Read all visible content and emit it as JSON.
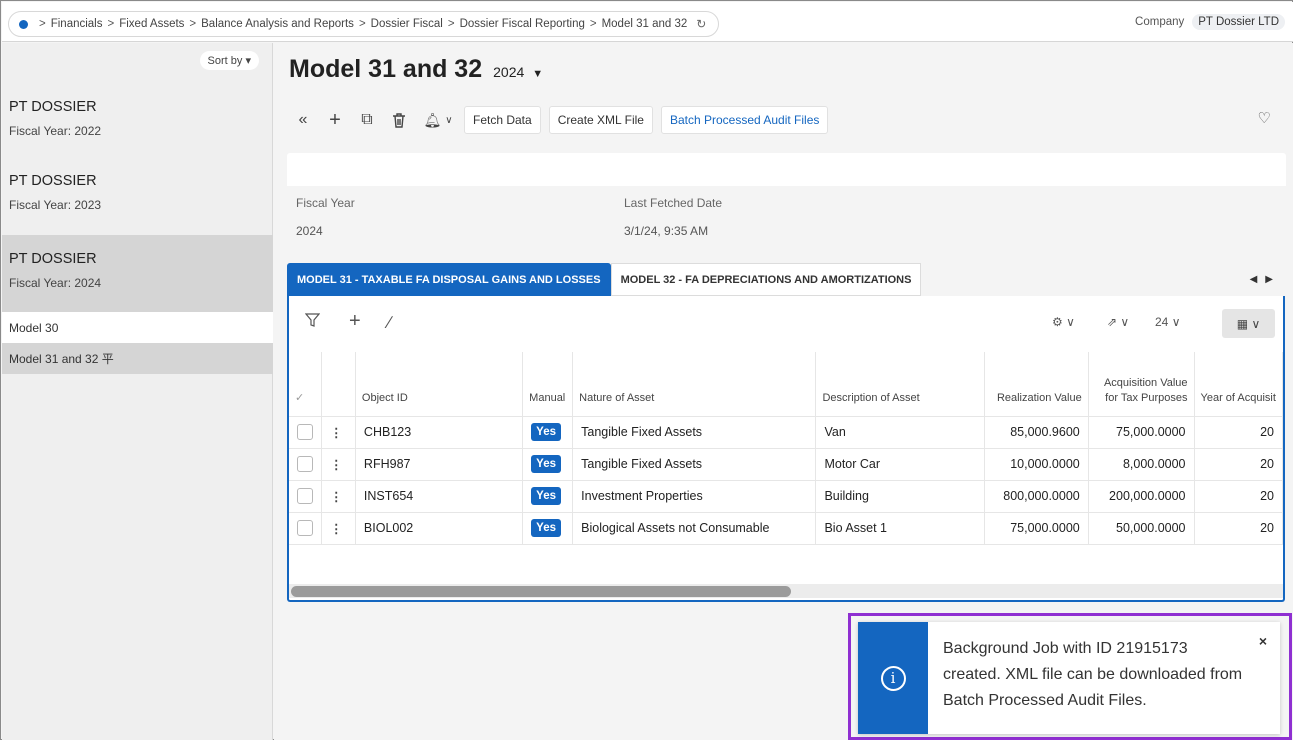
{
  "breadcrumb": {
    "items": [
      "Financials",
      "Fixed Assets",
      "Balance Analysis and Reports",
      "Dossier Fiscal",
      "Dossier Fiscal Reporting",
      "Model 31 and 32"
    ],
    "separator": ">",
    "refresh_icon": "refresh-icon"
  },
  "company": {
    "label": "Company",
    "value": "PT Dossier LTD"
  },
  "left": {
    "sort_label": "Sort by",
    "entries": [
      {
        "title": "PT DOSSIER",
        "sub": "Fiscal Year:  2022"
      },
      {
        "title": "PT DOSSIER",
        "sub": "Fiscal Year:  2023"
      },
      {
        "title": "PT DOSSIER",
        "sub": "Fiscal Year:  2024"
      }
    ],
    "subitems": [
      "Model 30",
      "Model 31 and 32 平"
    ]
  },
  "page": {
    "title": "Model 31 and 32",
    "year": "2024"
  },
  "toolbar": {
    "buttons": [
      "Fetch Data",
      "Create XML File",
      "Batch Processed Audit Files"
    ]
  },
  "info": {
    "fiscal_year_label": "Fiscal Year",
    "fiscal_year_value": "2024",
    "last_fetched_label": "Last Fetched Date",
    "last_fetched_value": "3/1/24, 9:35 AM"
  },
  "tabs": [
    "MODEL 31 - TAXABLE FA DISPOSAL GAINS AND LOSSES",
    "MODEL 32 - FA DEPRECIATIONS AND AMORTIZATIONS"
  ],
  "grid": {
    "page_size": "24",
    "columns": [
      "✓",
      "",
      "Object ID",
      "Manual",
      "Nature of Asset",
      "Description of Asset",
      "Realization Value",
      "Acquisition Value for Tax Purposes",
      "Year of Acquisit"
    ],
    "rows": [
      {
        "id": "CHB123",
        "manual": "Yes",
        "nature": "Tangible Fixed Assets",
        "desc": "Van",
        "realization": "85,000.9600",
        "acquisition": "75,000.0000",
        "year": "20"
      },
      {
        "id": "RFH987",
        "manual": "Yes",
        "nature": "Tangible Fixed Assets",
        "desc": "Motor Car",
        "realization": "10,000.0000",
        "acquisition": "8,000.0000",
        "year": "20"
      },
      {
        "id": "INST654",
        "manual": "Yes",
        "nature": "Investment Properties",
        "desc": "Building",
        "realization": "800,000.0000",
        "acquisition": "200,000.0000",
        "year": "20"
      },
      {
        "id": "BIOL002",
        "manual": "Yes",
        "nature": "Biological Assets not Consumable",
        "desc": "Bio Asset 1",
        "realization": "75,000.0000",
        "acquisition": "50,000.0000",
        "year": "20"
      }
    ]
  },
  "toast": {
    "message": "Background Job with ID 21915173 created. XML file can be downloaded from Batch Processed Audit Files.",
    "close": "×"
  },
  "colors": {
    "accent": "#1466c0",
    "highlight": "#8f2fd1"
  }
}
